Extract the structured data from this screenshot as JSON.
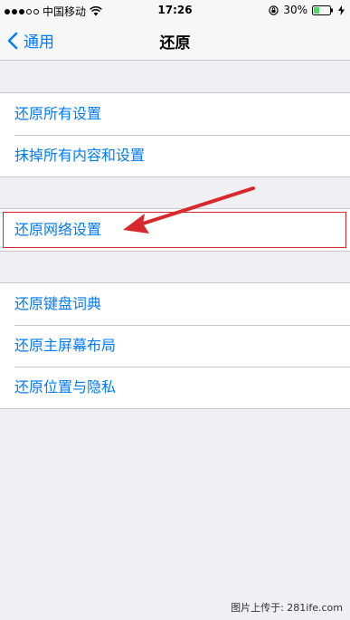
{
  "status_bar": {
    "carrier": "中国移动",
    "time": "17:26",
    "battery_percent": "30%"
  },
  "nav": {
    "back_label": "通用",
    "title": "还原"
  },
  "groups": [
    {
      "items": [
        "还原所有设置",
        "抹掉所有内容和设置"
      ]
    },
    {
      "items": [
        "还原网络设置"
      ]
    },
    {
      "items": [
        "还原键盘词典",
        "还原主屏幕布局",
        "还原位置与隐私"
      ]
    }
  ],
  "colors": {
    "accent": "#007aff",
    "highlight": "#d9282c",
    "background": "#efeff4"
  },
  "watermark": "图片上传于: 281ife.com"
}
